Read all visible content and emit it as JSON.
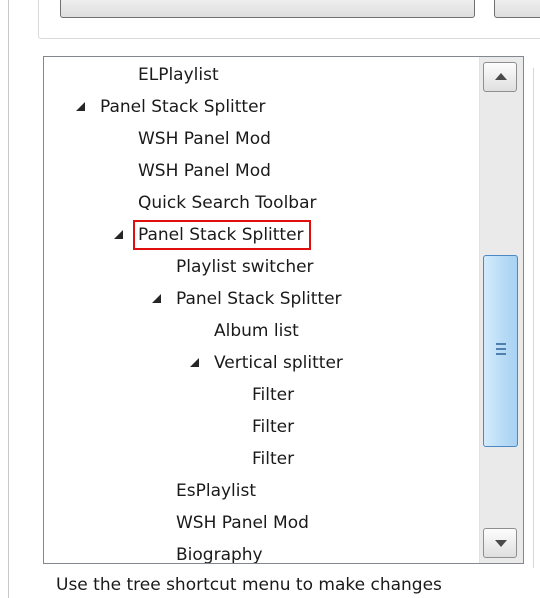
{
  "tree": {
    "items": [
      {
        "label": "ELPlaylist",
        "depth": 2,
        "expanded": false,
        "selected": false
      },
      {
        "label": "Panel Stack Splitter",
        "depth": 1,
        "expanded": true,
        "selected": false
      },
      {
        "label": "WSH Panel Mod",
        "depth": 2,
        "expanded": false,
        "selected": false
      },
      {
        "label": "WSH Panel Mod",
        "depth": 2,
        "expanded": false,
        "selected": false
      },
      {
        "label": "Quick Search Toolbar",
        "depth": 2,
        "expanded": false,
        "selected": false
      },
      {
        "label": "Panel Stack Splitter",
        "depth": 2,
        "expanded": true,
        "selected": true
      },
      {
        "label": "Playlist switcher",
        "depth": 3,
        "expanded": false,
        "selected": false
      },
      {
        "label": "Panel Stack Splitter",
        "depth": 3,
        "expanded": true,
        "selected": false
      },
      {
        "label": "Album list",
        "depth": 4,
        "expanded": false,
        "selected": false
      },
      {
        "label": "Vertical splitter",
        "depth": 4,
        "expanded": true,
        "selected": false
      },
      {
        "label": "Filter",
        "depth": 5,
        "expanded": false,
        "selected": false
      },
      {
        "label": "Filter",
        "depth": 5,
        "expanded": false,
        "selected": false
      },
      {
        "label": "Filter",
        "depth": 5,
        "expanded": false,
        "selected": false
      },
      {
        "label": "EsPlaylist",
        "depth": 3,
        "expanded": false,
        "selected": false
      },
      {
        "label": "WSH Panel Mod",
        "depth": 3,
        "expanded": false,
        "selected": false
      },
      {
        "label": "Biography",
        "depth": 3,
        "expanded": false,
        "selected": false
      }
    ]
  },
  "footer": {
    "hint": "Use the tree shortcut menu to make changes"
  },
  "colors": {
    "selection_outline": "#e10e0e",
    "scroll_thumb": "#b9dcf6",
    "text": "#1a1a1a"
  },
  "icons": {
    "expanded": "expanded-triangle-icon",
    "scroll_up": "scroll-up-arrow-icon",
    "scroll_down": "scroll-down-arrow-icon",
    "grip": "scroll-grip-icon"
  }
}
